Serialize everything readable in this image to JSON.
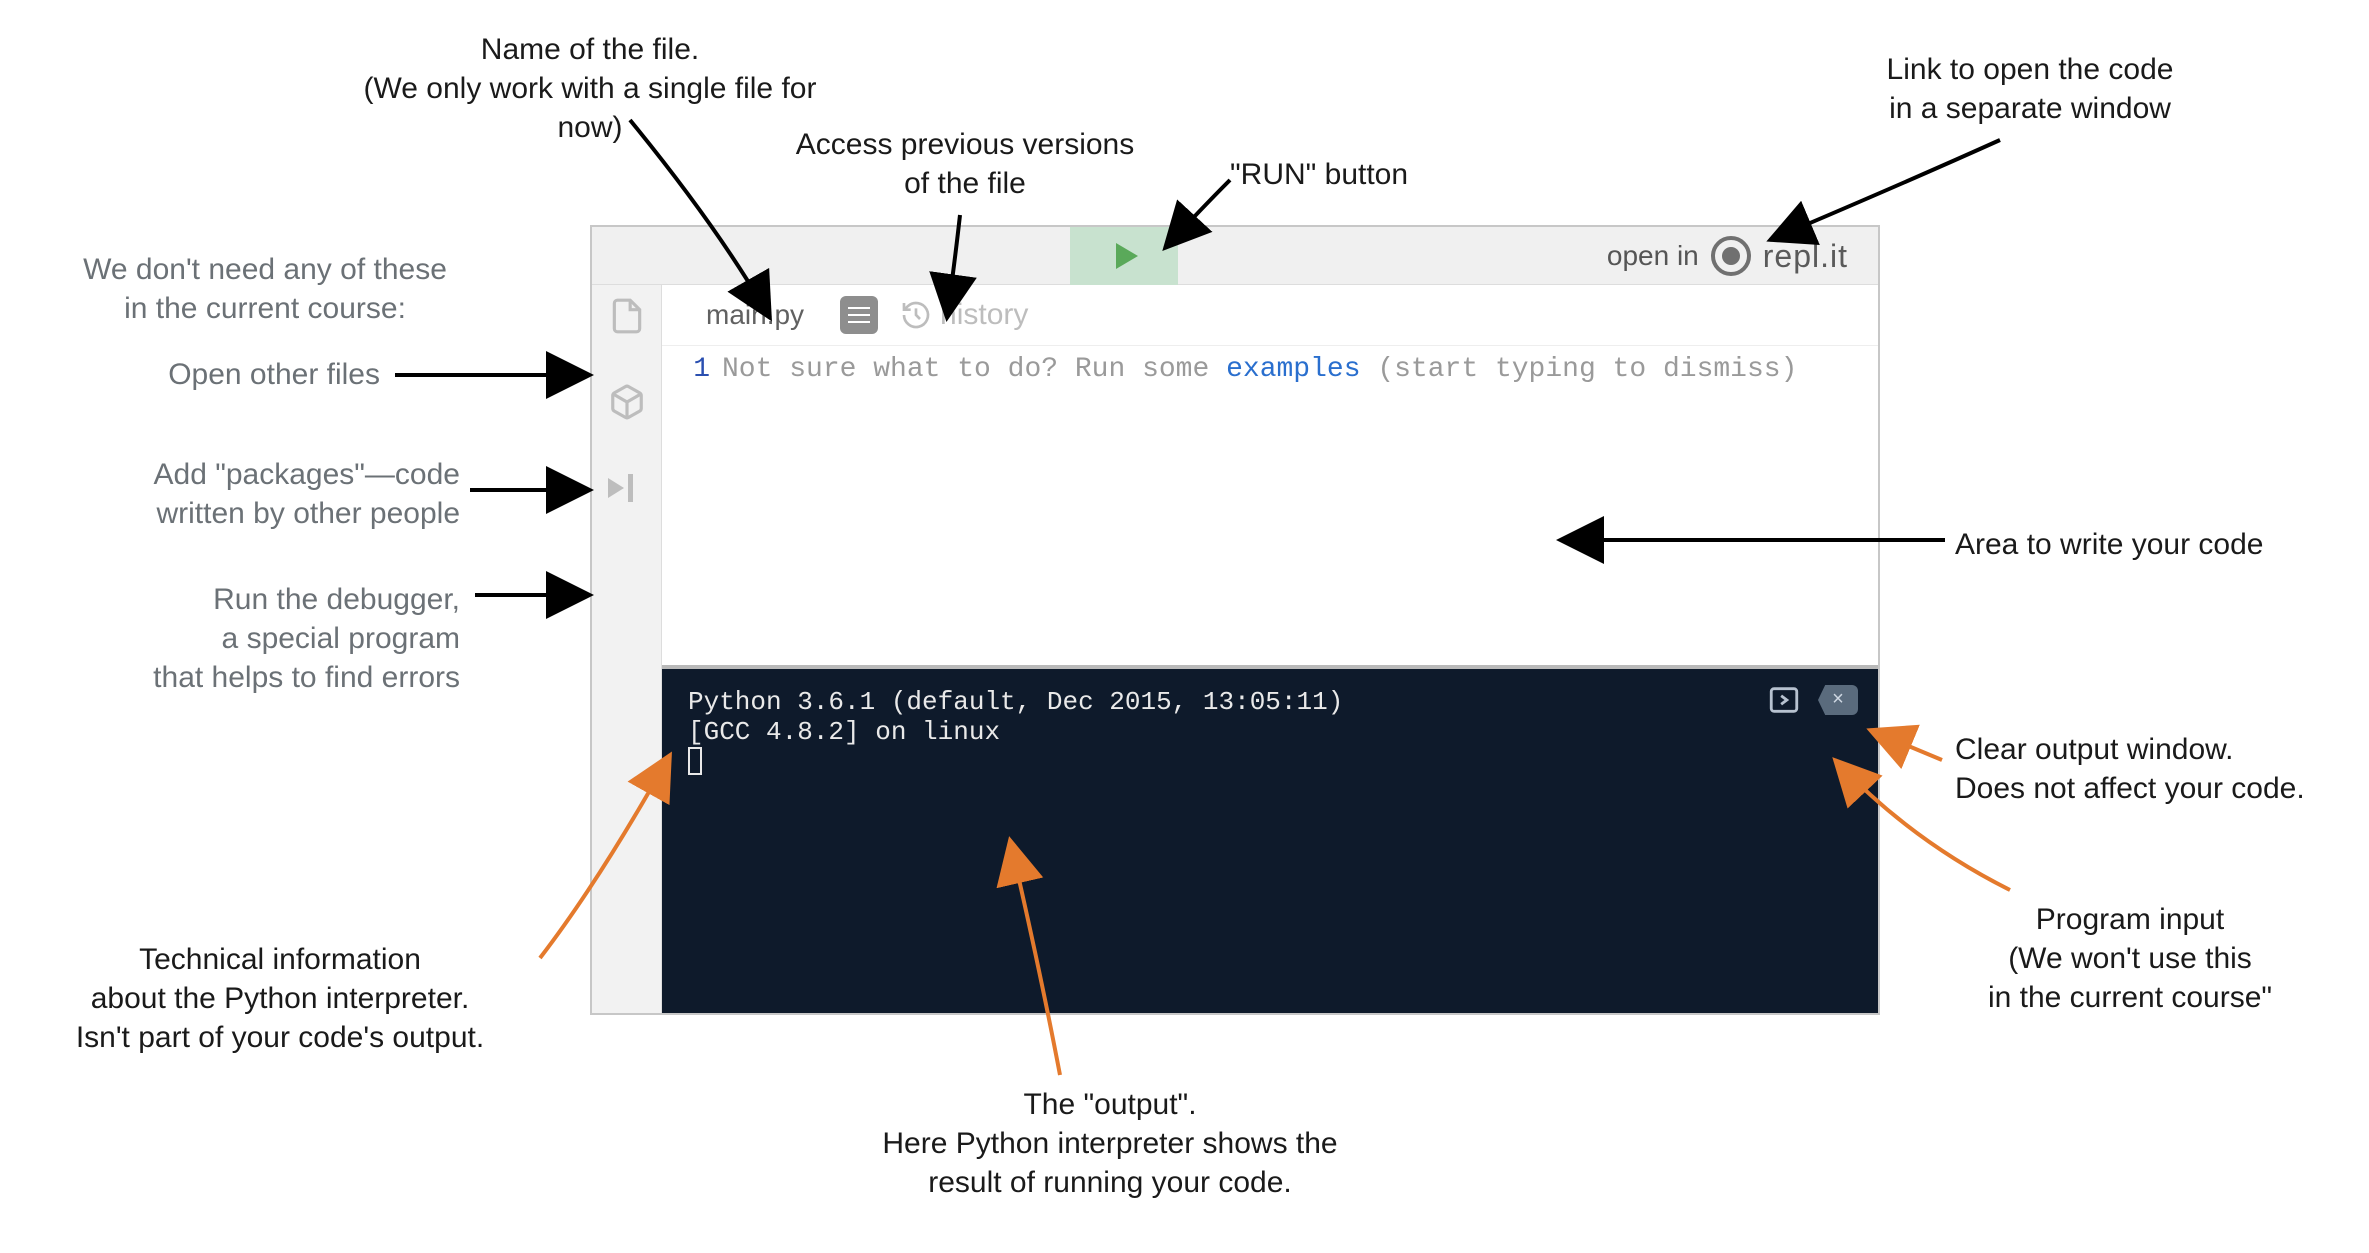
{
  "annotations": {
    "fileName": "Name of the file.\n(We only work with a single file for now)",
    "historyAccess": "Access previous versions\nof the file",
    "runBtn": "\"RUN\" button",
    "openLink": "Link to open the code\nin a separate window",
    "sidebarIntro": "We don't need any of these\nin the current course:",
    "openFiles": "Open other files",
    "packages": "Add \"packages\"—code\nwritten by other people",
    "debugger": "Run the debugger,\na special program\nthat helps to find errors",
    "codeArea": "Area to write your code",
    "clearOut": "Clear output window.\nDoes not affect your code.",
    "progInput": "Program input\n(We won't use this\nin the current course\"",
    "techInfo": "Technical information\nabout the Python interpreter.\nIsn't part of your code's output.",
    "output": "The \"output\".\nHere Python interpreter shows the\nresult of running your code."
  },
  "ide": {
    "fileTab": "main.py",
    "historyLabel": "history",
    "openInLabel": "open in",
    "replitBrand": "repl.it",
    "lineNumber": "1",
    "placeholder": {
      "pre": "Not sure what to do? Run some ",
      "link": "examples",
      "post": " (start typing to dismiss)"
    },
    "console": {
      "line1": "Python 3.6.1 (default, Dec 2015, 13:05:11)",
      "line2": "[GCC 4.8.2] on linux"
    }
  }
}
